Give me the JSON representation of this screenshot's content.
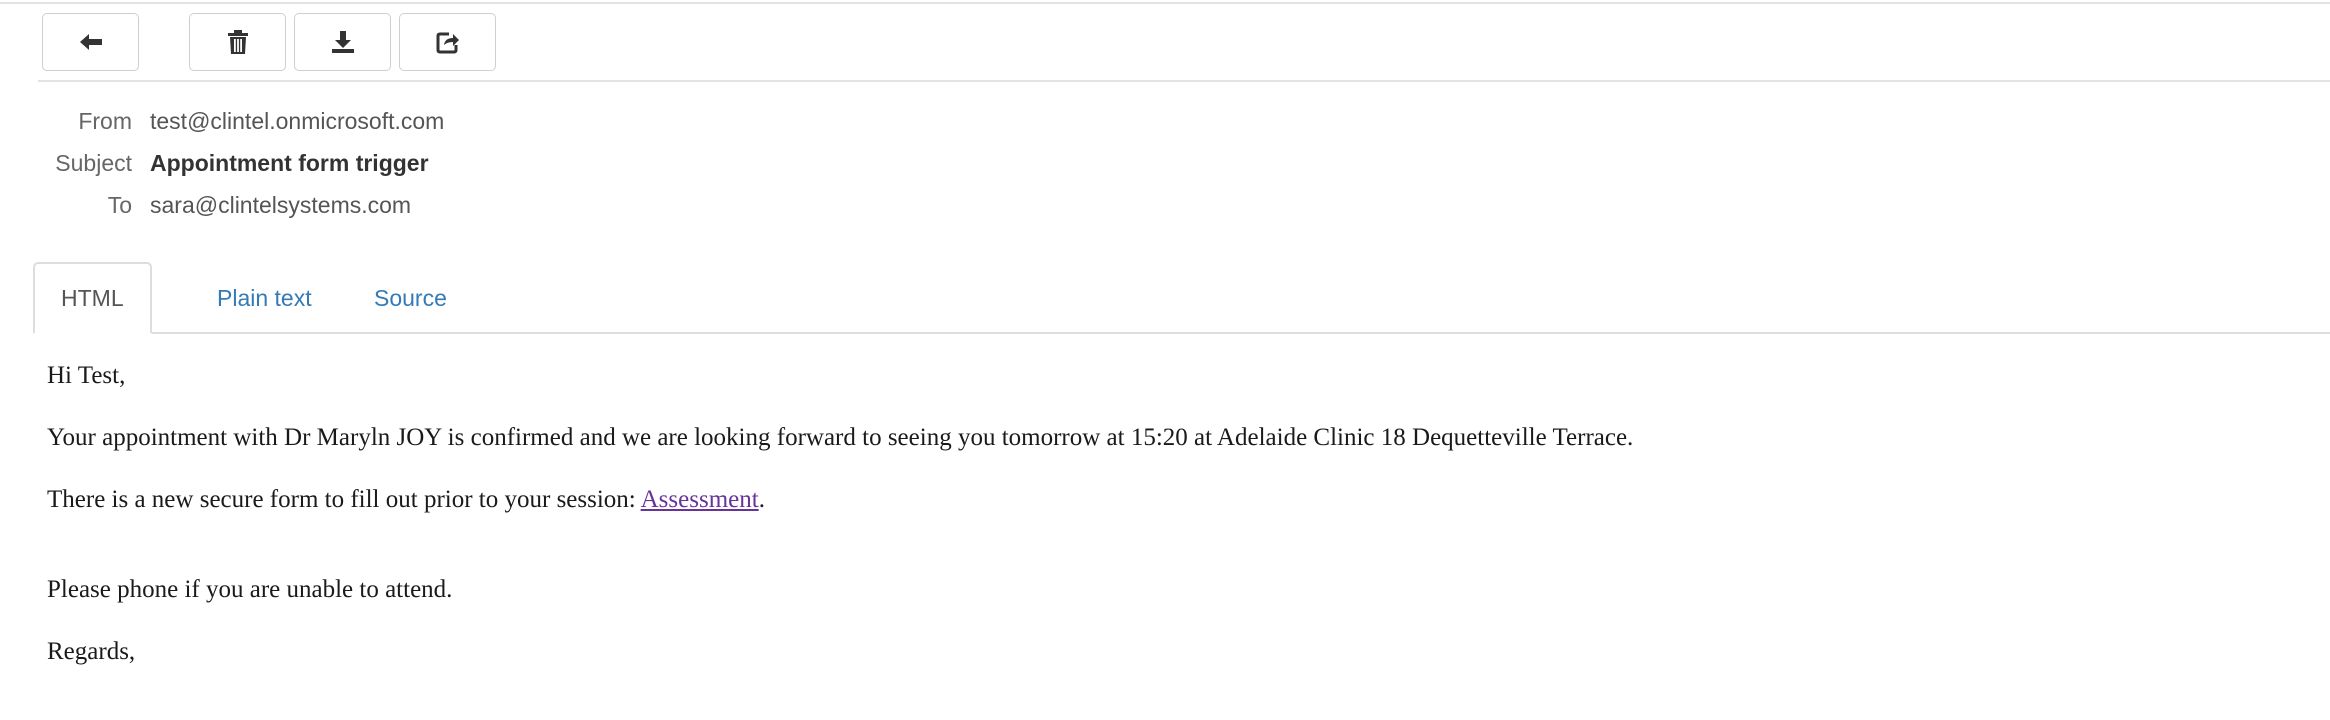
{
  "toolbar": {
    "buttons": [
      {
        "icon": "arrow-left-icon",
        "title": "Back"
      },
      {
        "icon": "trash-icon",
        "title": "Delete"
      },
      {
        "icon": "download-icon",
        "title": "Download"
      },
      {
        "icon": "share-icon",
        "title": "Open in new window"
      }
    ]
  },
  "headers": {
    "from_label": "From",
    "from_value": "test@clintel.onmicrosoft.com",
    "subject_label": "Subject",
    "subject_value": "Appointment form trigger",
    "to_label": "To",
    "to_value": "sara@clintelsystems.com"
  },
  "tabs": [
    {
      "label": "HTML",
      "active": true
    },
    {
      "label": "Plain text",
      "active": false
    },
    {
      "label": "Source",
      "active": false
    }
  ],
  "message": {
    "greeting": "Hi Test,",
    "line1": "Your appointment with Dr Maryln JOY is confirmed and we are looking forward to seeing you tomorrow at 15:20 at Adelaide Clinic 18 Dequetteville Terrace.",
    "line2_prefix": "There is a new secure form to fill out prior to your session: ",
    "line2_link": "Assessment",
    "line2_suffix": ".",
    "line3": "Please phone if you are unable to attend.",
    "closing": "Regards,"
  },
  "colors": {
    "link": "#663399",
    "tab_link": "#337ab7",
    "border": "#dddddd"
  }
}
